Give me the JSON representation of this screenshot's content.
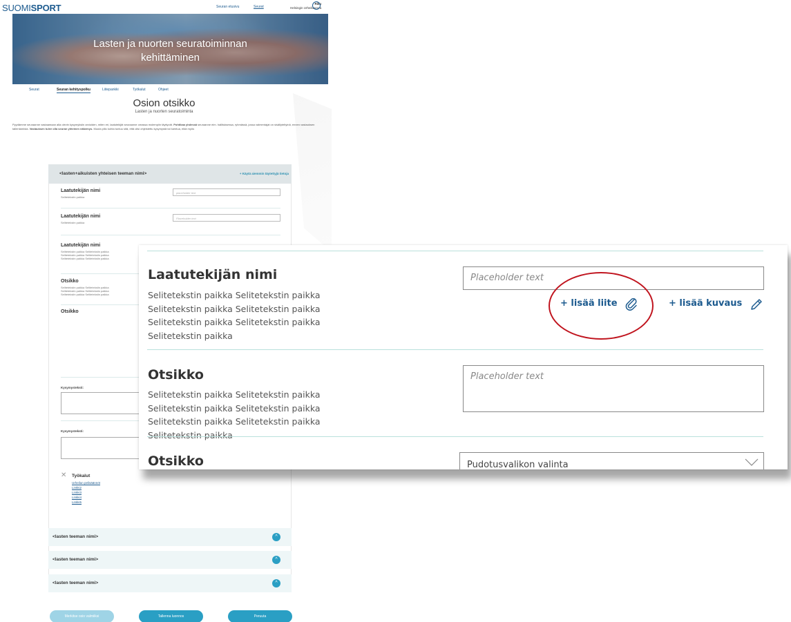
{
  "header": {
    "logo_left": "SUOMI",
    "logo_right": "SPORT",
    "nav": [
      "Seuran etusivu",
      "Seurat"
    ],
    "user_name": "Riku",
    "user_org": "Helsingin Urheiluseura"
  },
  "hero": {
    "title_line1": "Lasten ja nuorten seuratoiminnan",
    "title_line2": "kehittäminen"
  },
  "subnav": [
    "Seurat",
    "Seuran kehityspolku",
    "Liitepankki",
    "Työkalut",
    "Ohjeet"
  ],
  "section": {
    "title": "Osion otsikko",
    "subtitle": "Lasten ja nuorten seuratoiminta",
    "intro_plain1": "Pyydämme seuraanne vastaamaan alla olevin kysymyksiin arvioiden, miten eri, laatutekijät seuraanne omassa molempiin täyttyvät.",
    "intro_bold1": "Pohtikaa yhdessä",
    "intro_plain2": "seuraanne eim. hallituksessa, ryhmässä, jossa valmentajat on sisällyteltyinä, ennen vastauksen tallentamista.",
    "intro_bold2": "Vastauksen tulee olla seuran yhteinen näkemys.",
    "intro_plain3": "Muuta piilo kohta tuntuu sitä, että olisi ohjeistettu kysymystä tai luentua, eikä myös"
  },
  "theme": {
    "name": "<lasten+aikuisten yhteisen teeman nimi>",
    "use_previous": "+ Käytä aiemmin täytettyjä tietoja"
  },
  "bg_rows": [
    {
      "label": "Laatutekijän nimi",
      "desc": "Selitetekstin paikka",
      "placeholder": "placeholder text"
    },
    {
      "label": "Laatutekijän nimi",
      "desc": "Selitetekstin paikka",
      "placeholder": "Placeholder text"
    },
    {
      "label": "Laatutekijän nimi",
      "desc": "Selitetekstin paikka Selitetekstin paikka Selitetekstin paikka Selitetekstin paikka Selitetekstin paikka Selitetekstin paikka"
    },
    {
      "label": "Otsikko",
      "desc": "Selitetekstin paikka Selitetekstin paikka Selitetekstin paikka Selitetekstin paikka Selitetekstin paikka Selitetekstin paikka"
    },
    {
      "label": "Otsikko"
    }
  ],
  "question_label": "Kysymysteksti:",
  "tools": {
    "heading": "Työkalut",
    "links": [
      "Urheilun pelisäännöt",
      "Linkki2",
      "Linkki3",
      "Linkki4",
      "Linkki5"
    ]
  },
  "accordions": [
    "<lasten teeman nimi>",
    "<lasten teeman nimi>",
    "<lasten teeman nimi>"
  ],
  "buttons": {
    "mark_ready": "Merkitse osio valmiiksi",
    "save_draft": "Tallenna luonnos",
    "cancel": "Peruuta"
  },
  "zoom": {
    "row1": {
      "title": "Laatutekijän nimi",
      "desc": "Selitetekstin paikka Selitetekstin paikka Selitetekstin paikka Selitetekstin paikka Selitetekstin paikka Selitetekstin paikka Selitetekstin paikka",
      "placeholder": "Placeholder text",
      "add_attachment": "+ lisää liite",
      "add_description": "+ lisää kuvaus"
    },
    "row2": {
      "title": "Otsikko",
      "desc": "Selitetekstin paikka Selitetekstin paikka Selitetekstin paikka Selitetekstin paikka Selitetekstin paikka Selitetekstin paikka Selitetekstin paikka",
      "placeholder": "Placeholder text"
    },
    "row3": {
      "title": "Otsikko",
      "select_value": "Pudotusvalikon valinta"
    }
  },
  "colors": {
    "brand": "#1d5b8f",
    "accent": "#2a9fc4",
    "annotation": "#c0141e",
    "divider": "#b9e0dc"
  }
}
